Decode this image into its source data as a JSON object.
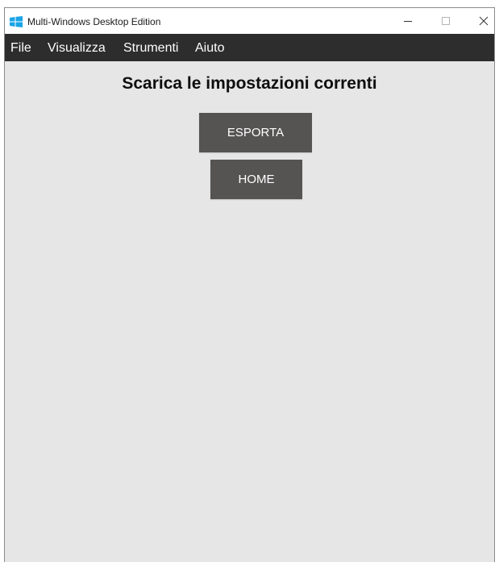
{
  "window": {
    "title": "Multi-Windows Desktop Edition",
    "app_icon": "windows-logo-icon",
    "controls": [
      "minimize-icon",
      "maximize-icon",
      "close-icon"
    ]
  },
  "menu": {
    "items": [
      {
        "label": "File"
      },
      {
        "label": "Visualizza"
      },
      {
        "label": "Strumenti"
      },
      {
        "label": "Aiuto"
      }
    ]
  },
  "main": {
    "heading": "Scarica le impostazioni correnti",
    "export_button": "ESPORTA",
    "home_button": "HOME"
  },
  "colors": {
    "menubar_bg": "#2d2d2d",
    "content_bg": "#e6e6e6",
    "button_bg": "#565353",
    "app_icon_accent": "#1aa5e6"
  }
}
